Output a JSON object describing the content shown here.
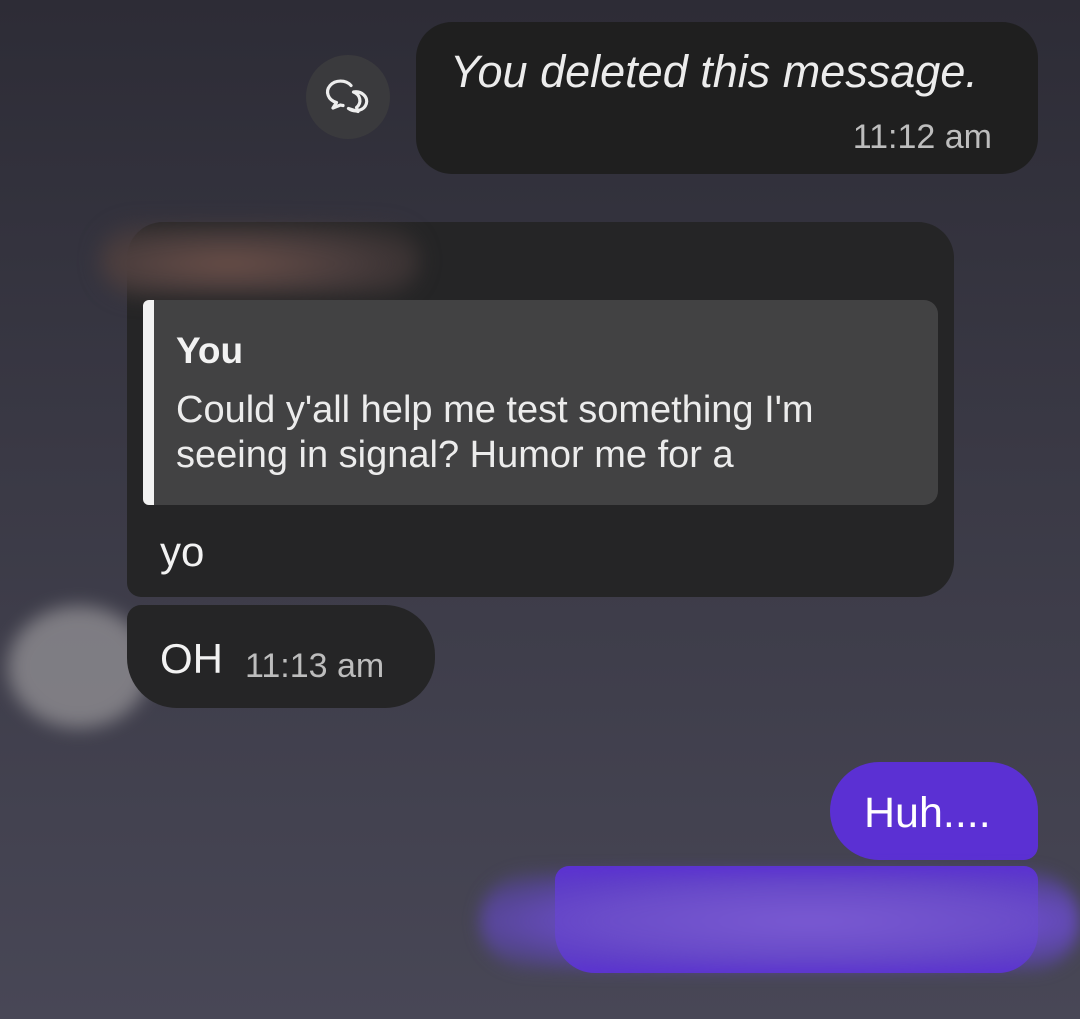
{
  "colors": {
    "outgoing_bubble": "#5b30d3",
    "incoming_bubble": "#252526",
    "deleted_bubble": "#1f1f1f",
    "quote_background": "#424243",
    "timestamp": "#bdbdbd"
  },
  "reaction_button": {
    "icon": "speech-bubbles-icon"
  },
  "messages": {
    "deleted": {
      "text": "You deleted this message.",
      "time": "11:12 am"
    },
    "reply": {
      "quote_author": "You",
      "quote_text": "Could y'all help me test something I'm seeing in signal? Humor me for a",
      "body": "yo"
    },
    "oh": {
      "text": "OH",
      "time": "11:13 am"
    },
    "huh": {
      "text": "Huh...."
    }
  }
}
